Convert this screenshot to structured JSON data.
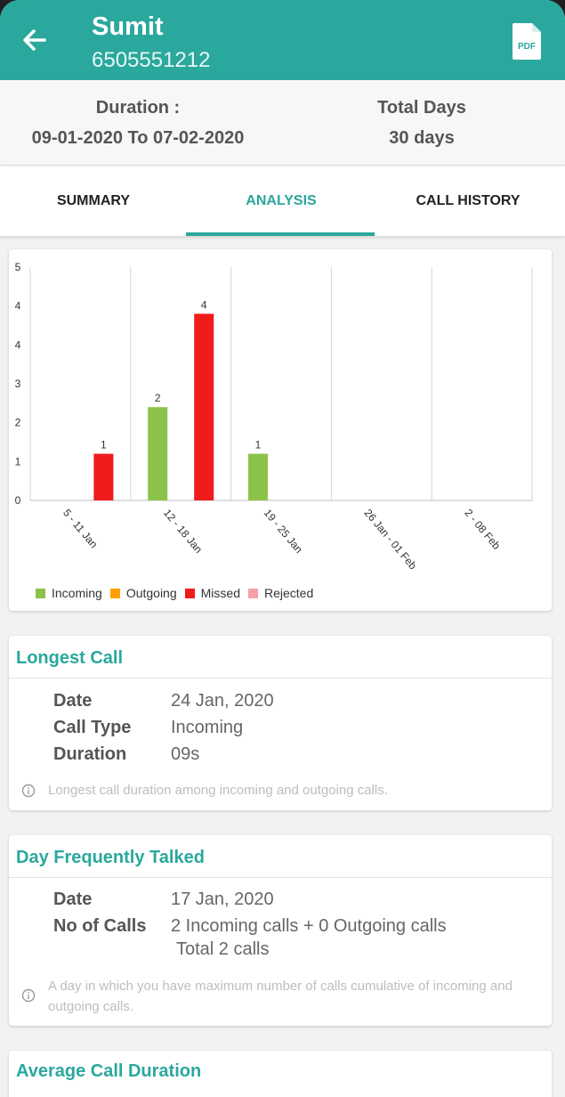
{
  "header": {
    "name": "Sumit",
    "phone": "6505551212"
  },
  "period": {
    "duration_label": "Duration :",
    "duration_value": "09-01-2020 To 07-02-2020",
    "total_days_label": "Total Days",
    "total_days_value": "30 days"
  },
  "tabs": [
    {
      "label": "SUMMARY",
      "active": false
    },
    {
      "label": "ANALYSIS",
      "active": true
    },
    {
      "label": "CALL HISTORY",
      "active": false
    }
  ],
  "chart_data": {
    "type": "bar",
    "categories": [
      "5 - 11 Jan",
      "12 - 18 Jan",
      "19 - 25 Jan",
      "26 Jan - 01 Feb",
      "2 - 08 Feb"
    ],
    "series": [
      {
        "name": "Incoming",
        "color": "#8bc34a",
        "values": [
          0,
          2,
          1,
          0,
          0
        ]
      },
      {
        "name": "Outgoing",
        "color": "#ffa000",
        "values": [
          0,
          0,
          0,
          0,
          0
        ]
      },
      {
        "name": "Missed",
        "color": "#f01b1b",
        "values": [
          1,
          4,
          0,
          0,
          0
        ]
      },
      {
        "name": "Rejected",
        "color": "#f4a0a8",
        "values": [
          0,
          0,
          0,
          0,
          0
        ]
      }
    ],
    "y_tick_labels": [
      "0",
      "1",
      "2",
      "3",
      "4",
      "4",
      "5"
    ],
    "ylim": [
      0,
      5
    ],
    "grid": "vertical",
    "legend_position": "bottom-left"
  },
  "longest_call": {
    "title": "Longest Call",
    "date_label": "Date",
    "date_value": "24 Jan, 2020",
    "type_label": "Call Type",
    "type_value": "Incoming",
    "duration_label": "Duration",
    "duration_value": "09s",
    "note": "Longest call duration among incoming and outgoing calls."
  },
  "frequent_day": {
    "title": "Day Frequently Talked",
    "date_label": "Date",
    "date_value": "17 Jan, 2020",
    "calls_label": "No of Calls",
    "calls_value": "2 Incoming calls + 0 Outgoing calls",
    "calls_total": "Total 2 calls",
    "note": "A day in which you have maximum number of calls cumulative of incoming and outgoing calls."
  },
  "average_call": {
    "title": "Average Call Duration"
  },
  "icons": {
    "back": "arrow-left-icon",
    "pdf": "pdf-file-icon",
    "info": "info-icon"
  }
}
